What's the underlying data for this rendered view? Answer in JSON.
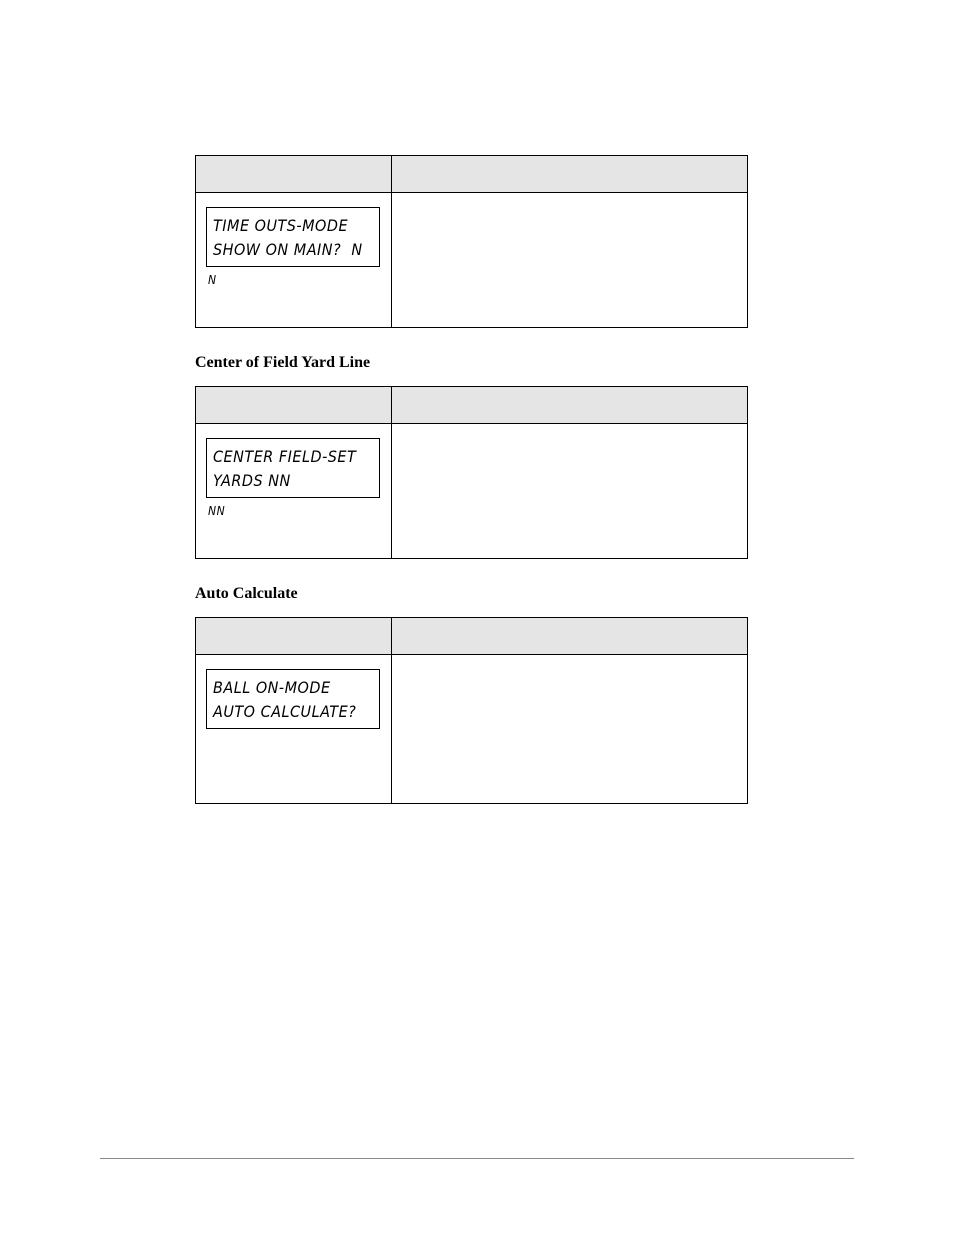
{
  "tables": [
    {
      "lcd_line1": "TIME OUTS-MODE",
      "lcd_line2": "SHOW ON MAIN?  N",
      "lcd_default": "N"
    }
  ],
  "sections": [
    {
      "heading": "Center of Field Yard Line",
      "lcd_line1": "CENTER FIELD-SET",
      "lcd_line2": "YARDS NN",
      "lcd_default": "NN"
    },
    {
      "heading": "Auto Calculate",
      "lcd_line1": "BALL ON-MODE",
      "lcd_line2": "AUTO CALCULATE?",
      "lcd_default": ""
    }
  ]
}
